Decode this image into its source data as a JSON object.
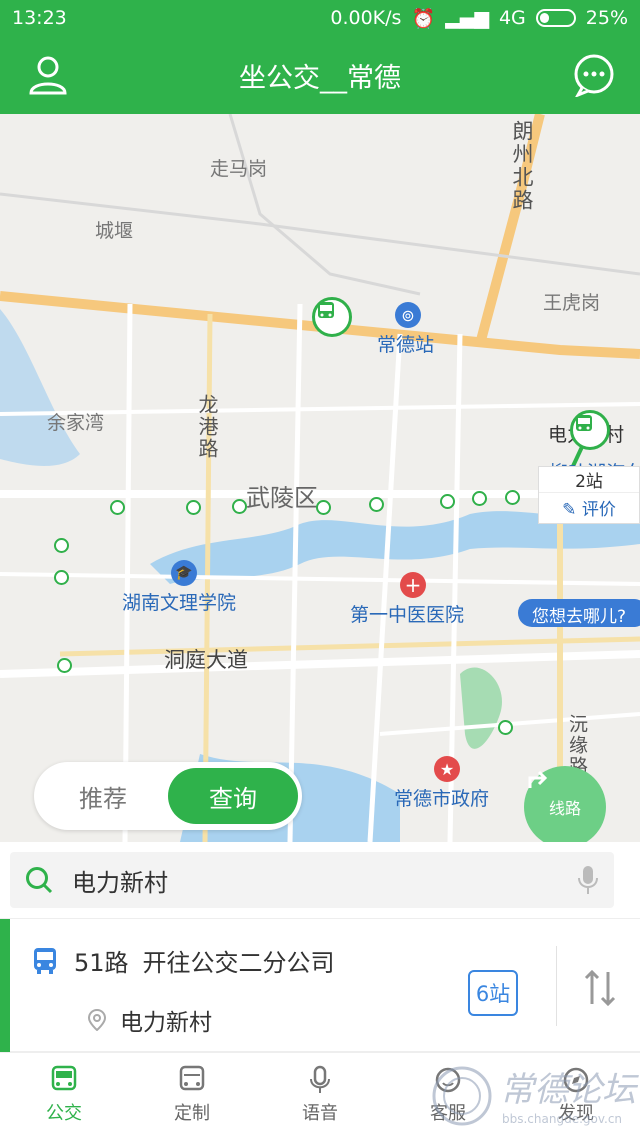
{
  "status_bar": {
    "time": "13:23",
    "network_speed": "0.00K/s",
    "network_type": "4G",
    "battery": "25%"
  },
  "app_bar": {
    "title": "坐公交__常德"
  },
  "map": {
    "labels": {
      "zou_ma_gang": "走马岗",
      "cheng_yan": "城堰",
      "chang_de_zhan": "常德站",
      "wang_hu_gang": "王虎岗",
      "lang_zhou_bei_lu": "朗州北路",
      "yu_jia_wan": "余家湾",
      "long_gang_lu": "龙港路",
      "wu_ling_qu": "武陵区",
      "hu_nan_wen_li_xue_yuan": "湖南文理学院",
      "di_yi_zhong_yi_yi_yuan": "第一中医医院",
      "dong_ting_da_dao": "洞庭大道",
      "chang_de_shi_zheng_fu": "常德市政府",
      "liu_ye_hu_qi_che": "柳叶湖汽车",
      "dian_li_cun": "电力新村",
      "dong_yuan_lu": "沅缘路"
    },
    "popup": {
      "stations": "2站",
      "rate": "评价"
    },
    "tip": "您想去哪儿?",
    "route_fab": "线路"
  },
  "toggle": {
    "recommend": "推荐",
    "query": "查询"
  },
  "search": {
    "value": "电力新村"
  },
  "route_card": {
    "route": "51路",
    "direction": "开往公交二分公司",
    "stop": "电力新村",
    "stations": "6站"
  },
  "tabs": [
    {
      "label": "公交",
      "icon": "bus-icon"
    },
    {
      "label": "定制",
      "icon": "custom-bus-icon"
    },
    {
      "label": "语音",
      "icon": "microphone-icon"
    },
    {
      "label": "客服",
      "icon": "service-icon"
    },
    {
      "label": "发现",
      "icon": "discover-icon"
    }
  ],
  "watermark": {
    "text": "常德论坛",
    "url": "bbs.changde.gov.cn"
  },
  "colors": {
    "primary": "#2fb24b",
    "blue": "#3a7bd5",
    "map_bg": "#f0efec"
  }
}
